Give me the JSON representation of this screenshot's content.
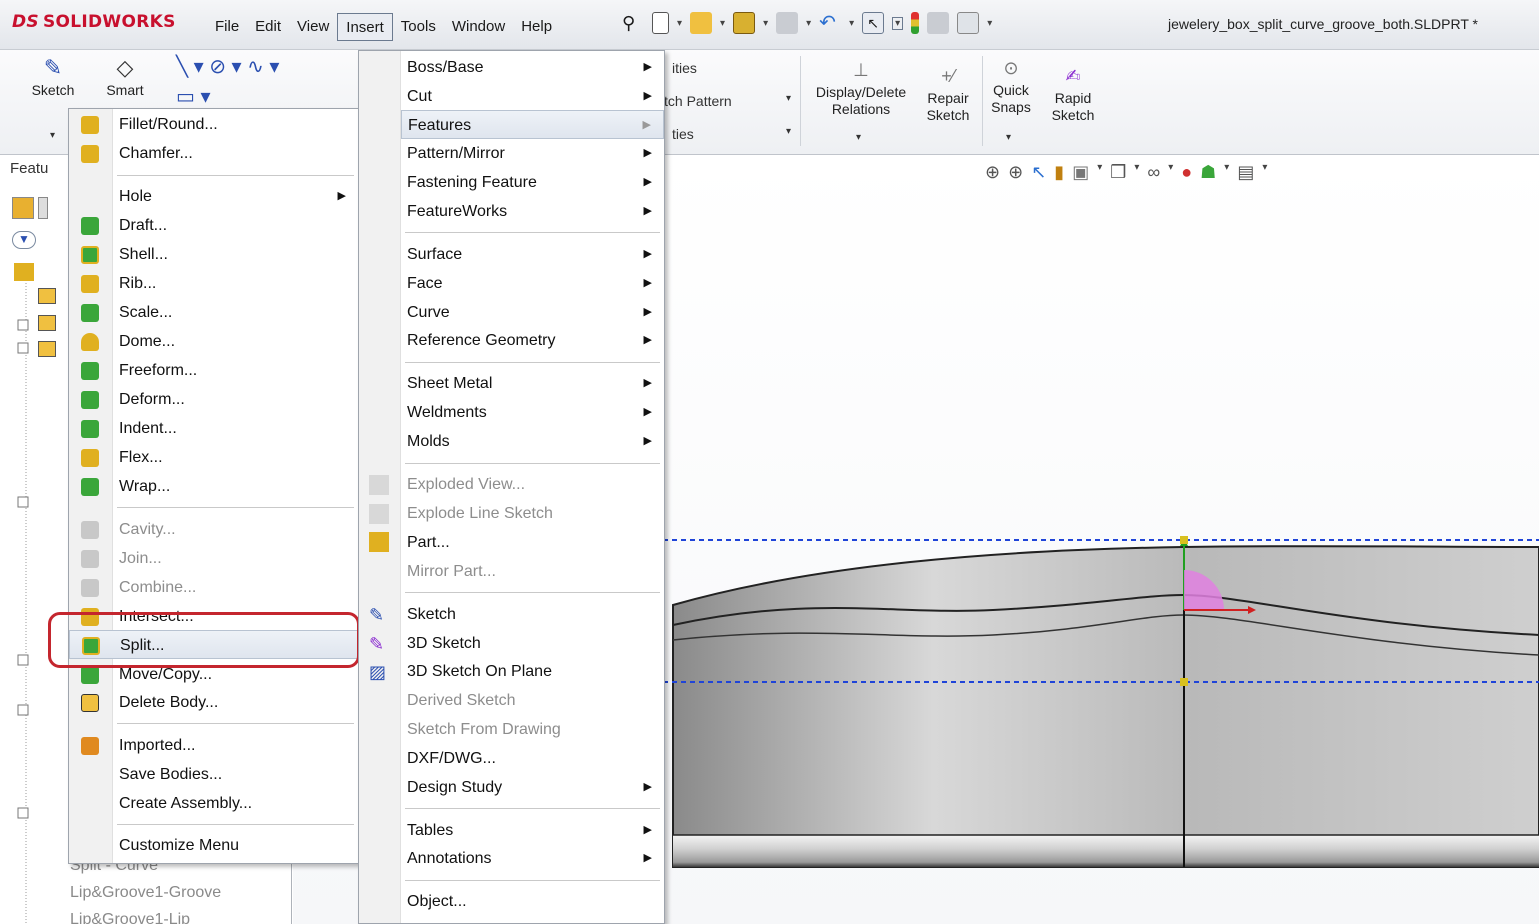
{
  "app": {
    "logo_mark": "DS",
    "logo_text": "SOLIDWORKS",
    "document_title": "jewelery_box_split_curve_groove_both.SLDPRT *"
  },
  "menubar": {
    "items": [
      "File",
      "Edit",
      "View",
      "Insert",
      "Tools",
      "Window",
      "Help"
    ],
    "active": "Insert"
  },
  "command_manager": {
    "sketch": "Sketch",
    "smart_dimension": "Smart",
    "ities": "ities",
    "tch_pattern": "tch Pattern",
    "ties": "ties",
    "display_delete": "Display/Delete",
    "relations": "Relations",
    "repair": "Repair",
    "repair_sketch": "Sketch",
    "quick": "Quick",
    "snaps": "Snaps",
    "rapid": "Rapid",
    "rapid_sketch": "Sketch"
  },
  "feature_manager": {
    "tab_label": "Featu",
    "tree_items": [
      "Split - Curve",
      "Lip&Groove1-Groove",
      "Lip&Groove1-Lip"
    ]
  },
  "features_submenu": {
    "items": [
      {
        "label": "Fillet/Round...",
        "icon": "fillet-icon",
        "color": "#e0b020"
      },
      {
        "label": "Chamfer...",
        "icon": "chamfer-icon",
        "color": "#e0b020"
      },
      {
        "label": "Hole",
        "submenu": true
      },
      {
        "label": "Draft...",
        "icon": "draft-icon",
        "color": "#3aa63a"
      },
      {
        "label": "Shell...",
        "icon": "shell-icon",
        "color": "#3aa63a"
      },
      {
        "label": "Rib...",
        "icon": "rib-icon",
        "color": "#e0b020"
      },
      {
        "label": "Scale...",
        "icon": "scale-icon",
        "color": "#3aa63a"
      },
      {
        "label": "Dome...",
        "icon": "dome-icon",
        "color": "#e0b020"
      },
      {
        "label": "Freeform...",
        "icon": "freeform-icon",
        "color": "#3aa63a"
      },
      {
        "label": "Deform...",
        "icon": "deform-icon",
        "color": "#3aa63a"
      },
      {
        "label": "Indent...",
        "icon": "indent-icon",
        "color": "#3aa63a"
      },
      {
        "label": "Flex...",
        "icon": "flex-icon",
        "color": "#e0b020"
      },
      {
        "label": "Wrap...",
        "icon": "wrap-icon",
        "color": "#3aa63a"
      },
      {
        "label": "Cavity...",
        "icon": "cavity-icon",
        "disabled": true
      },
      {
        "label": "Join...",
        "icon": "join-icon",
        "disabled": true
      },
      {
        "label": "Combine...",
        "icon": "combine-icon",
        "disabled": true
      },
      {
        "label": "Intersect...",
        "icon": "intersect-icon",
        "color": "#e0b020"
      },
      {
        "label": "Split...",
        "icon": "split-icon",
        "color": "#3aa63a",
        "highlighted": true
      },
      {
        "label": "Move/Copy...",
        "icon": "move-copy-icon",
        "color": "#3aa63a"
      },
      {
        "label": "Delete Body...",
        "icon": "delete-body-icon",
        "color": "#333333"
      },
      {
        "label": "Imported...",
        "icon": "imported-icon",
        "color": "#e08a20"
      },
      {
        "label": "Save Bodies..."
      },
      {
        "label": "Create Assembly..."
      },
      {
        "label": "Customize Menu"
      }
    ]
  },
  "insert_menu": {
    "items": [
      {
        "label": "Boss/Base",
        "submenu": true
      },
      {
        "label": "Cut",
        "submenu": true
      },
      {
        "label": "Features",
        "submenu": true,
        "highlighted": true
      },
      {
        "label": "Pattern/Mirror",
        "submenu": true
      },
      {
        "label": "Fastening Feature",
        "submenu": true
      },
      {
        "label": "FeatureWorks",
        "submenu": true
      },
      {
        "label": "Surface",
        "submenu": true
      },
      {
        "label": "Face",
        "submenu": true
      },
      {
        "label": "Curve",
        "submenu": true
      },
      {
        "label": "Reference Geometry",
        "submenu": true
      },
      {
        "label": "Sheet Metal",
        "submenu": true
      },
      {
        "label": "Weldments",
        "submenu": true
      },
      {
        "label": "Molds",
        "submenu": true
      },
      {
        "label": "Exploded View...",
        "disabled": true
      },
      {
        "label": "Explode Line Sketch",
        "disabled": true
      },
      {
        "label": "Part..."
      },
      {
        "label": "Mirror Part...",
        "disabled": true
      },
      {
        "label": "Sketch"
      },
      {
        "label": "3D Sketch"
      },
      {
        "label": "3D Sketch On Plane"
      },
      {
        "label": "Derived Sketch",
        "disabled": true
      },
      {
        "label": "Sketch From Drawing",
        "disabled": true
      },
      {
        "label": "DXF/DWG..."
      },
      {
        "label": "Design Study",
        "submenu": true
      },
      {
        "label": "Tables",
        "submenu": true
      },
      {
        "label": "Annotations",
        "submenu": true
      },
      {
        "label": "Object..."
      }
    ]
  }
}
